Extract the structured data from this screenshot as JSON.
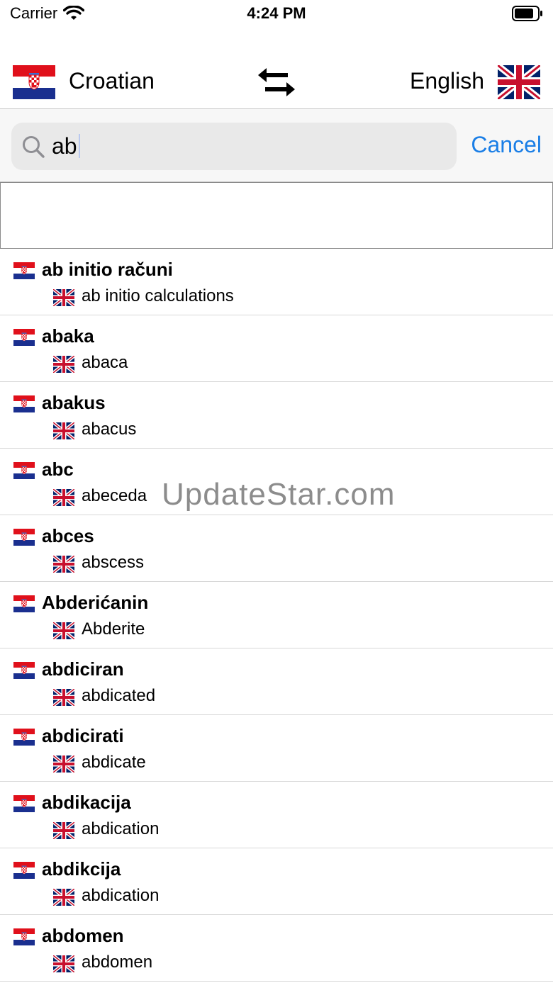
{
  "status_bar": {
    "carrier": "Carrier",
    "time": "4:24 PM"
  },
  "languages": {
    "source": "Croatian",
    "target": "English"
  },
  "search": {
    "query": "ab",
    "cancel_label": "Cancel"
  },
  "entries": [
    {
      "term": "ab initio računi",
      "translation": "ab initio calculations"
    },
    {
      "term": "abaka",
      "translation": "abaca"
    },
    {
      "term": "abakus",
      "translation": "abacus"
    },
    {
      "term": "abc",
      "translation": "abeceda"
    },
    {
      "term": "abces",
      "translation": "abscess"
    },
    {
      "term": "Abderićanin",
      "translation": "Abderite"
    },
    {
      "term": "abdiciran",
      "translation": "abdicated"
    },
    {
      "term": "abdicirati",
      "translation": "abdicate"
    },
    {
      "term": "abdikacija",
      "translation": "abdication"
    },
    {
      "term": "abdikcija",
      "translation": "abdication"
    },
    {
      "term": "abdomen",
      "translation": "abdomen"
    }
  ],
  "watermark": "UpdateStar.com",
  "colors": {
    "accent": "#1a7ee6",
    "croatia_red": "#e0101b",
    "croatia_blue": "#1a2f8f",
    "uk_blue": "#012169",
    "uk_red": "#c8102e"
  }
}
